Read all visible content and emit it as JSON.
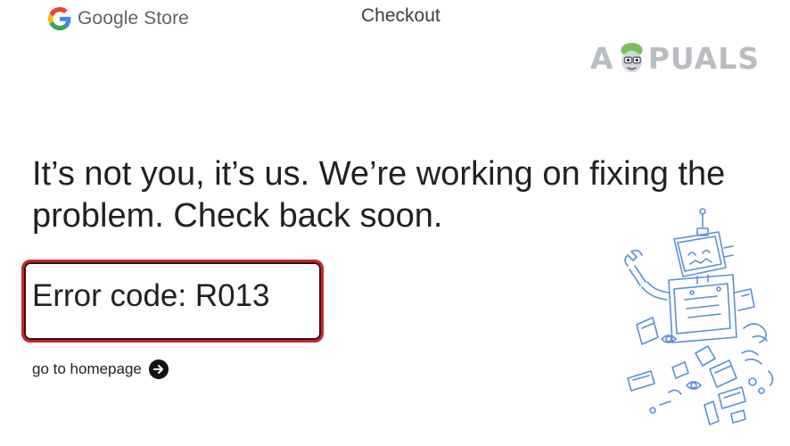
{
  "header": {
    "brand": "Google Store",
    "page_title": "Checkout"
  },
  "watermark": {
    "prefix": "A",
    "suffix": "PUALS"
  },
  "main": {
    "headline_line1": "It’s not you, it’s us. We’re working on fixing the",
    "headline_line2": "problem. Check back soon.",
    "error_code": "Error code: R013",
    "home_link": "go to homepage"
  },
  "icons": {
    "logo": "google-g-icon",
    "link": "arrow-right-circle-icon",
    "illustration": "broken-robot-illustration"
  },
  "colors": {
    "google_blue": "#4285F4",
    "google_red": "#EA4335",
    "google_yellow": "#FBBC05",
    "google_green": "#34A853",
    "highlight_red": "#C1272D",
    "robot_blue": "#5B8FD6"
  }
}
